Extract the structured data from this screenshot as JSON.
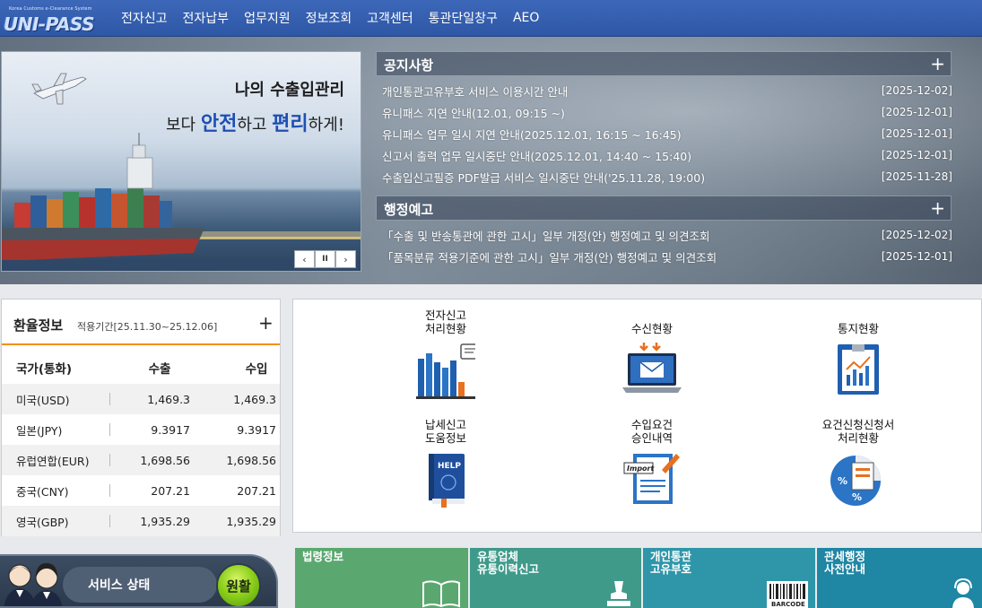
{
  "header": {
    "logo_tagline": "Korea Customs e-Clearance System",
    "logo_text": "UNI-PASS",
    "nav": [
      "전자신고",
      "전자납부",
      "업무지원",
      "정보조회",
      "고객센터",
      "통관단일창구",
      "AEO"
    ]
  },
  "banner": {
    "line1": "나의 수출입관리",
    "line2_pre": "보다 ",
    "line2_hl1": "안전",
    "line2_mid": "하고 ",
    "line2_hl2": "편리",
    "line2_post": "하게!",
    "controls": {
      "prev": "‹",
      "pause": "II",
      "next": "›"
    }
  },
  "notices": {
    "title": "공지사항",
    "plus": "+",
    "items": [
      {
        "text": "개인통관고유부호 서비스 이용시간 안내",
        "date": "[2025-12-02]"
      },
      {
        "text": "유니패스 지연 안내(12.01, 09:15 ~)",
        "date": "[2025-12-01]"
      },
      {
        "text": "유니패스 업무 일시 지연 안내(2025.12.01, 16:15 ~ 16:45)",
        "date": "[2025-12-01]"
      },
      {
        "text": "신고서 출력 업무 일시중단 안내(2025.12.01, 14:40 ~ 15:40)",
        "date": "[2025-12-01]"
      },
      {
        "text": "수출입신고필증 PDF발급 서비스 일시중단 안내('25.11.28, 19:00)",
        "date": "[2025-11-28]"
      }
    ]
  },
  "admin_notice": {
    "title": "행정예고",
    "plus": "+",
    "items": [
      {
        "text": "「수출 및 반송통관에 관한 고시」일부 개정(안) 행정예고 및 의견조회",
        "date": "[2025-12-02]"
      },
      {
        "text": "「품목분류 적용기준에 관한 고시」일부 개정(안) 행정예고 및 의견조회",
        "date": "[2025-12-01]"
      }
    ]
  },
  "exchange": {
    "title": "환율정보",
    "period": "적용기간[25.11.30~25.12.06]",
    "plus": "+",
    "headers": {
      "country": "국가(통화)",
      "export": "수출",
      "import": "수입"
    },
    "rows": [
      {
        "country": "미국(USD)",
        "export": "1,469.3",
        "import": "1,469.3"
      },
      {
        "country": "일본(JPY)",
        "export": "9.3917",
        "import": "9.3917"
      },
      {
        "country": "유럽연합(EUR)",
        "export": "1,698.56",
        "import": "1,698.56"
      },
      {
        "country": "중국(CNY)",
        "export": "207.21",
        "import": "207.21"
      },
      {
        "country": "영국(GBP)",
        "export": "1,935.29",
        "import": "1,935.29"
      }
    ]
  },
  "quick_menu": [
    {
      "line1": "전자신고",
      "line2": "처리현황",
      "icon": "bar-chart-icon"
    },
    {
      "line1": "",
      "line2": "수신현황",
      "icon": "laptop-mail-icon"
    },
    {
      "line1": "",
      "line2": "통지현황",
      "icon": "report-chart-icon"
    },
    {
      "line1": "납세신고",
      "line2": "도움정보",
      "icon": "help-book-icon"
    },
    {
      "line1": "수입요건",
      "line2": "승인내역",
      "icon": "import-document-icon"
    },
    {
      "line1": "요건신청신청서",
      "line2": "처리현황",
      "icon": "percent-document-icon"
    }
  ],
  "import_icon_text": "Import",
  "help_icon_text": "HELP",
  "service": {
    "label": "서비스 상태",
    "state": "원활"
  },
  "tiles": [
    {
      "line1": "법령정보",
      "line2": "",
      "color": "#5aa86f",
      "icon": "book-icon"
    },
    {
      "line1": "유통업체",
      "line2": "유통이력신고",
      "color": "#3f9a8a",
      "icon": "stamp-icon"
    },
    {
      "line1": "개인통관",
      "line2": "고유부호",
      "color": "#2f96a9",
      "icon": "barcode-icon",
      "badge": "BARCODE"
    },
    {
      "line1": "관세행정",
      "line2": "사전안내",
      "color": "#1f86a4",
      "icon": "headset-icon"
    }
  ]
}
